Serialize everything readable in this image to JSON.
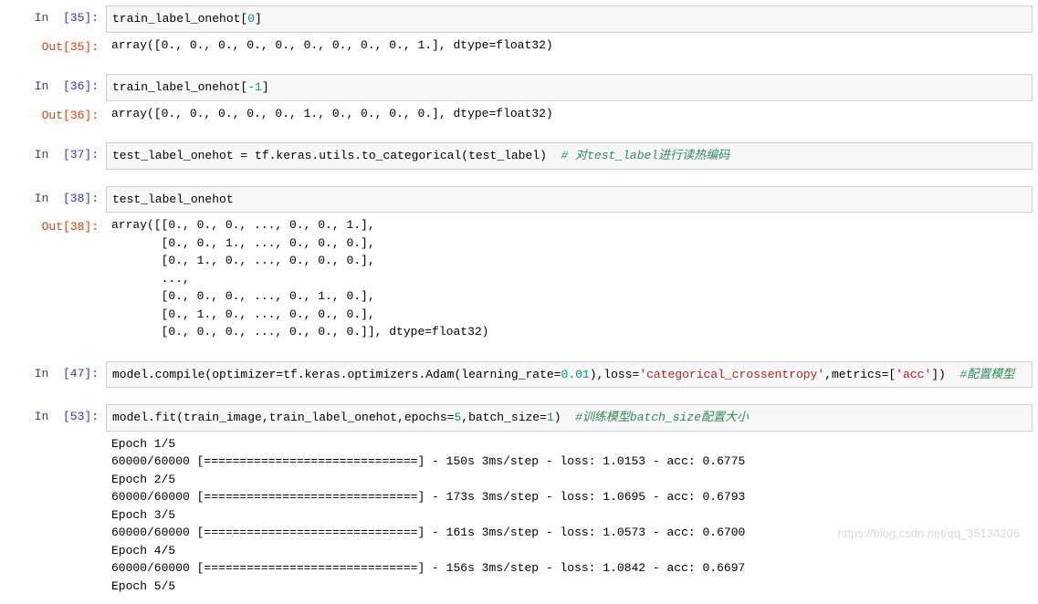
{
  "labels": {
    "in": "In  ",
    "out": "Out"
  },
  "cells": [
    {
      "type": "in",
      "n": 35,
      "code": {
        "pre": "train_label_onehot[",
        "num": "0",
        "post": "]"
      }
    },
    {
      "type": "out",
      "n": 35,
      "text": "array([0., 0., 0., 0., 0., 0., 0., 0., 0., 1.], dtype=float32)"
    },
    {
      "type": "spacer"
    },
    {
      "type": "in",
      "n": 36,
      "code": {
        "pre": "train_label_onehot[",
        "num": "-1",
        "post": "]"
      }
    },
    {
      "type": "out",
      "n": 36,
      "text": "array([0., 0., 0., 0., 0., 1., 0., 0., 0., 0.], dtype=float32)"
    },
    {
      "type": "spacer"
    },
    {
      "type": "in",
      "n": 37,
      "code": {
        "line": "test_label_onehot = tf.keras.utils.to_categorical(test_label)  ",
        "cmt": "# 对test_label进行读热编码"
      }
    },
    {
      "type": "spacer"
    },
    {
      "type": "in",
      "n": 38,
      "code": {
        "line": "test_label_onehot"
      }
    },
    {
      "type": "out",
      "n": 38,
      "text": "array([[0., 0., 0., ..., 0., 0., 1.],\n       [0., 0., 1., ..., 0., 0., 0.],\n       [0., 1., 0., ..., 0., 0., 0.],\n       ...,\n       [0., 0., 0., ..., 0., 1., 0.],\n       [0., 1., 0., ..., 0., 0., 0.],\n       [0., 0., 0., ..., 0., 0., 0.]], dtype=float32)"
    },
    {
      "type": "spacer"
    },
    {
      "type": "in",
      "n": 47,
      "code": {
        "p1": "model.compile(optimizer=tf.keras.optimizers.Adam(learning_rate=",
        "num1": "0.01",
        "p2": "),loss=",
        "str1": "'categorical_crossentropy'",
        "p3": ",metrics=[",
        "str2": "'acc'",
        "p4": "])  ",
        "cmt": "#配置模型"
      }
    },
    {
      "type": "spacer"
    },
    {
      "type": "in",
      "n": 53,
      "code": {
        "p1": "model.fit(train_image,train_label_onehot,epochs=",
        "num1": "5",
        "p2": ",batch_size=",
        "num2": "1",
        "p3": ")  ",
        "cmt": "#训练模型batch_size配置大小"
      }
    },
    {
      "type": "out-plain",
      "text": "Epoch 1/5\n60000/60000 [==============================] - 150s 3ms/step - loss: 1.0153 - acc: 0.6775\nEpoch 2/5\n60000/60000 [==============================] - 173s 3ms/step - loss: 1.0695 - acc: 0.6793\nEpoch 3/5\n60000/60000 [==============================] - 161s 3ms/step - loss: 1.0573 - acc: 0.6700\nEpoch 4/5\n60000/60000 [==============================] - 156s 3ms/step - loss: 1.0842 - acc: 0.6697\nEpoch 5/5"
    }
  ],
  "watermark": "https://blog.csdn.net/qq_35134206"
}
